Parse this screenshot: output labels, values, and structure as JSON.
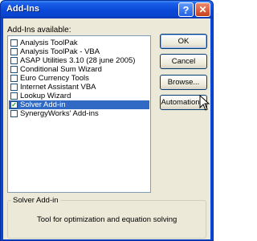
{
  "window": {
    "title": "Add-Ins",
    "help_glyph": "?",
    "close_glyph": "✕"
  },
  "list": {
    "label": "Add-Ins available:",
    "items": [
      {
        "label": "Analysis ToolPak",
        "checked": false,
        "selected": false
      },
      {
        "label": "Analysis ToolPak - VBA",
        "checked": false,
        "selected": false
      },
      {
        "label": "ASAP Utilities 3.10 (28 june 2005)",
        "checked": false,
        "selected": false
      },
      {
        "label": "Conditional Sum Wizard",
        "checked": false,
        "selected": false
      },
      {
        "label": "Euro Currency Tools",
        "checked": false,
        "selected": false
      },
      {
        "label": "Internet Assistant VBA",
        "checked": false,
        "selected": false
      },
      {
        "label": "Lookup Wizard",
        "checked": false,
        "selected": false
      },
      {
        "label": "Solver Add-in",
        "checked": true,
        "selected": true
      },
      {
        "label": "SynergyWorks' Add-ins",
        "checked": false,
        "selected": false
      }
    ]
  },
  "buttons": {
    "ok": "OK",
    "cancel": "Cancel",
    "browse": "Browse...",
    "automation": "Automation..."
  },
  "description": {
    "title": "Solver Add-in",
    "text": "Tool for optimization and equation solving"
  },
  "icons": {
    "check": "✓",
    "cursor": "arrow-cursor-icon"
  }
}
